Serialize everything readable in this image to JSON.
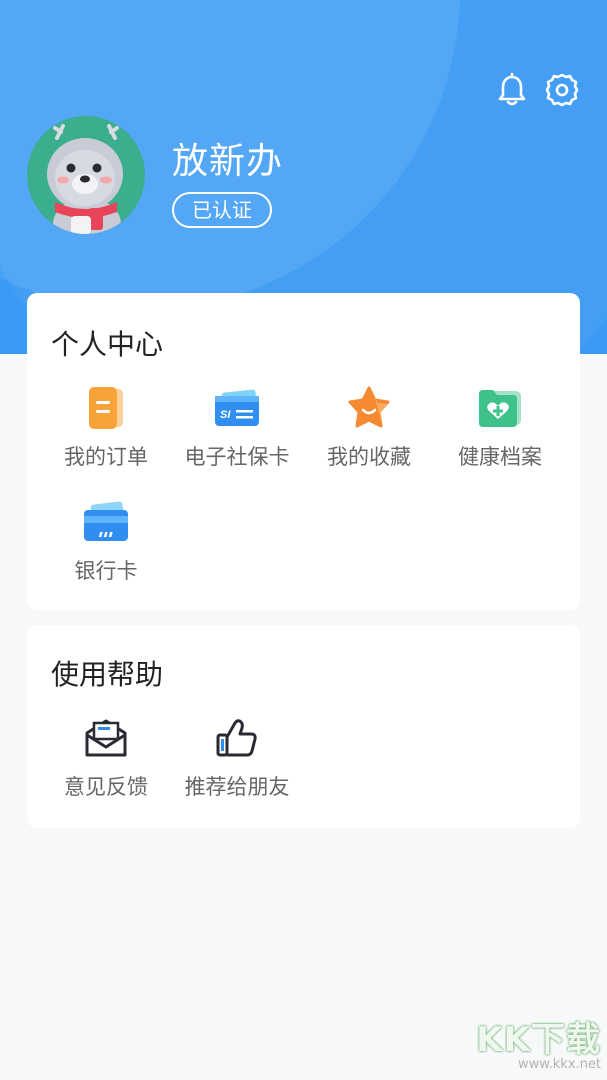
{
  "profile": {
    "name": "放新办",
    "status_badge": "已认证"
  },
  "personal_center": {
    "title": "个人中心",
    "items": [
      {
        "label": "我的订单",
        "icon": "order-icon"
      },
      {
        "label": "电子社保卡",
        "icon": "social-security-card-icon"
      },
      {
        "label": "我的收藏",
        "icon": "star-icon"
      },
      {
        "label": "健康档案",
        "icon": "health-folder-icon"
      },
      {
        "label": "银行卡",
        "icon": "bank-card-icon"
      }
    ]
  },
  "help": {
    "title": "使用帮助",
    "items": [
      {
        "label": "意见反馈",
        "icon": "feedback-mail-icon"
      },
      {
        "label": "推荐给朋友",
        "icon": "thumbs-up-icon"
      }
    ]
  },
  "watermark": {
    "logo": "KK下载",
    "url": "www.kkx.net"
  },
  "colors": {
    "header": "#3a9af4",
    "card": "#ffffff",
    "background": "#f7f8fa"
  }
}
